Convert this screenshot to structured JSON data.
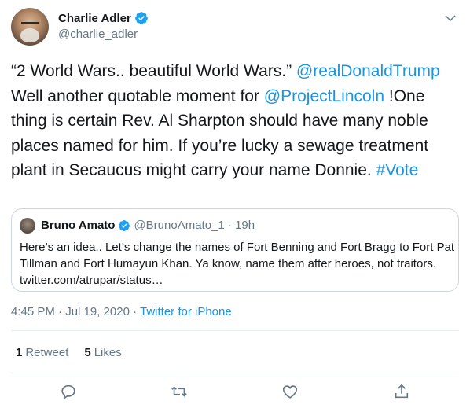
{
  "author": {
    "display_name": "Charlie Adler",
    "handle": "@charlie_adler"
  },
  "tweet": {
    "text_parts": [
      {
        "t": "“2 World Wars.. beautiful World Wars.” ",
        "link": false
      },
      {
        "t": "@realDonaldTrump",
        "link": true
      },
      {
        "t": "  Well another quotable moment for ",
        "link": false
      },
      {
        "t": "@ProjectLincoln",
        "link": true
      },
      {
        "t": " !One thing is certain Rev. Al Sharpton should have many noble places named for him. If you’re lucky a sewage treatment plant in Secaucus might carry your name Donnie. ",
        "link": false
      },
      {
        "t": "#Vote",
        "link": true
      }
    ],
    "timestamp": "4:45 PM · Jul 19, 2020 · ",
    "source": "Twitter for iPhone"
  },
  "quoted": {
    "display_name": "Bruno Amato",
    "meta": "@BrunoAmato_1 · 19h",
    "text": "Here’s an idea.. Let’s change the names of Fort Benning and Fort Bragg to Fort Pat Tillman and Fort Humayun Khan. Ya know, name them after heroes, not traitors. twitter.com/atrupar/status…"
  },
  "stats": {
    "retweets_count": "1",
    "retweets_label": "Retweet",
    "likes_count": "5",
    "likes_label": "Likes"
  },
  "colors": {
    "link": "#1b95e0",
    "muted": "#657786",
    "verified": "#1da1f2"
  },
  "icons": [
    "verified-badge-icon",
    "caret-down-icon",
    "reply-icon",
    "retweet-icon",
    "like-icon",
    "share-icon"
  ]
}
